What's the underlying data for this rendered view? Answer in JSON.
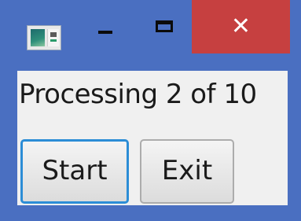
{
  "window": {
    "title_icon": "application-window-icon",
    "minimize_icon": "minimize-icon",
    "maximize_icon": "maximize-icon",
    "close_icon": "close-icon",
    "close_glyph": "✕",
    "colors": {
      "frame": "#4a6fc1",
      "close_hover": "#c64040",
      "client": "#f0f0f0",
      "focus_border": "#2c8dd6"
    }
  },
  "main": {
    "status_text": "Processing 2 of 10",
    "progress": {
      "current": 2,
      "total": 10
    },
    "buttons": {
      "start_label": "Start",
      "exit_label": "Exit"
    }
  }
}
